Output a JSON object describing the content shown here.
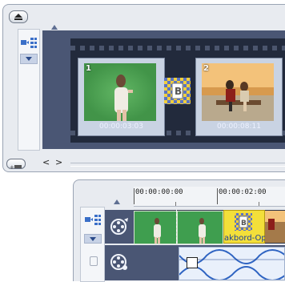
{
  "storyboard": {
    "clips": [
      {
        "number": "1",
        "timecode": "00:00:03:03"
      },
      {
        "number": "2",
        "timecode": "00:00:08:11"
      }
    ],
    "nav": {
      "prev": "<",
      "next": ">"
    }
  },
  "timeline": {
    "ruler": {
      "labels": [
        "00:00:00:00",
        "00:00:02:00"
      ]
    },
    "transition_label": "akbord-Op"
  },
  "colors": {
    "storyboard_bg": "#4a5674",
    "filmstrip": "#222a3c",
    "clip_green": "#3f9e4f",
    "transition_yellow": "#f3df3a",
    "label_blue": "#1a3f9a"
  },
  "icons": [
    "eject-icon",
    "storyboard-mode-icon",
    "chevron-down-icon",
    "add-track-icon",
    "film-reel-icon",
    "overlay-reel-icon",
    "lock-icon"
  ]
}
